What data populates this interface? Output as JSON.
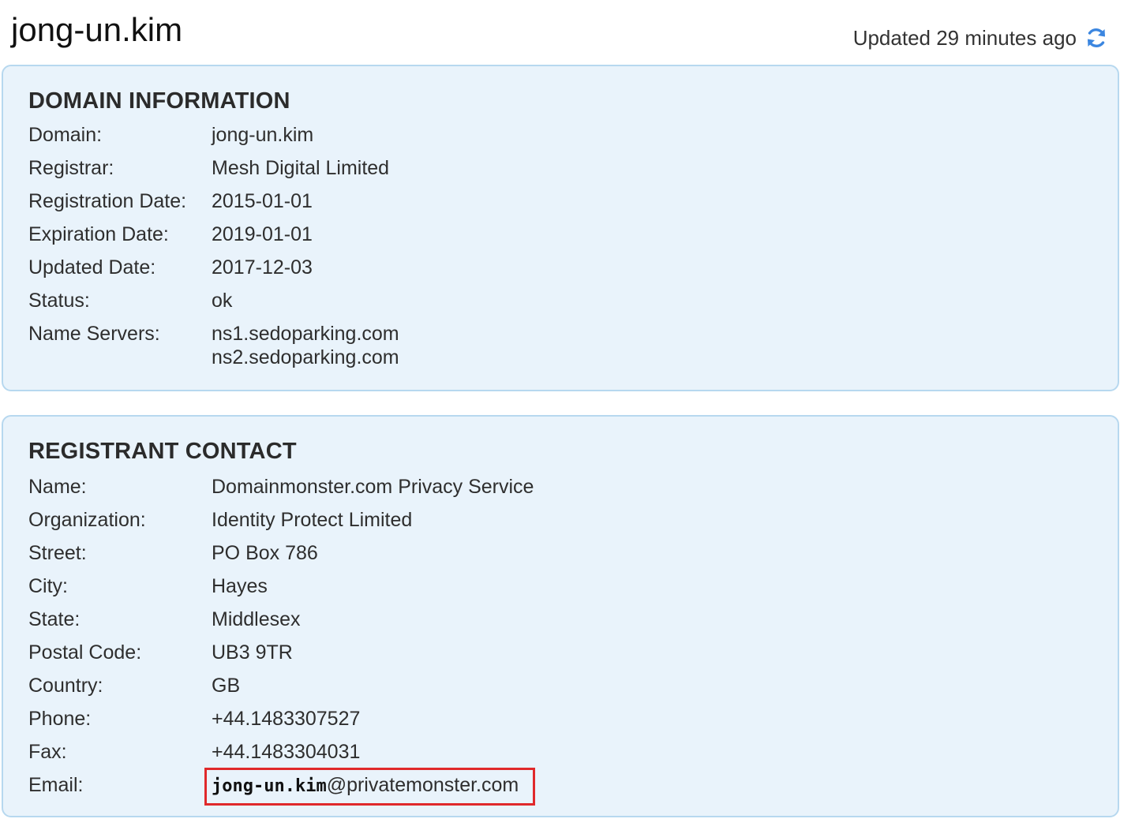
{
  "header": {
    "title": "jong-un.kim",
    "updated_text": "Updated 29 minutes ago",
    "refresh_icon": "refresh-icon"
  },
  "domain_information": {
    "heading": "DOMAIN INFORMATION",
    "rows": [
      {
        "label": "Domain:",
        "value": "jong-un.kim"
      },
      {
        "label": "Registrar:",
        "value": "Mesh Digital Limited"
      },
      {
        "label": "Registration Date:",
        "value": "2015-01-01"
      },
      {
        "label": "Expiration Date:",
        "value": "2019-01-01"
      },
      {
        "label": "Updated Date:",
        "value": "2017-12-03"
      },
      {
        "label": "Status:",
        "value": "ok"
      }
    ],
    "name_servers": {
      "label": "Name Servers:",
      "values": [
        "ns1.sedoparking.com",
        "ns2.sedoparking.com"
      ]
    }
  },
  "registrant_contact": {
    "heading": "REGISTRANT CONTACT",
    "rows": [
      {
        "label": "Name:",
        "value": "Domainmonster.com Privacy Service"
      },
      {
        "label": "Organization:",
        "value": "Identity Protect Limited"
      },
      {
        "label": "Street:",
        "value": "PO Box 786"
      },
      {
        "label": "City:",
        "value": "Hayes"
      },
      {
        "label": "State:",
        "value": "Middlesex"
      },
      {
        "label": "Postal Code:",
        "value": "UB3 9TR"
      },
      {
        "label": "Country:",
        "value": "GB"
      },
      {
        "label": "Phone:",
        "value": "+44.1483307527"
      },
      {
        "label": "Fax:",
        "value": "+44.1483304031"
      }
    ],
    "email": {
      "label": "Email:",
      "user": "jong-un.kim",
      "domain": "@privatemonster.com"
    }
  },
  "colors": {
    "panel_background": "#e9f3fb",
    "panel_border": "#b7d8ef",
    "highlight_border": "#e0292b",
    "refresh_icon": "#3b86e0"
  }
}
